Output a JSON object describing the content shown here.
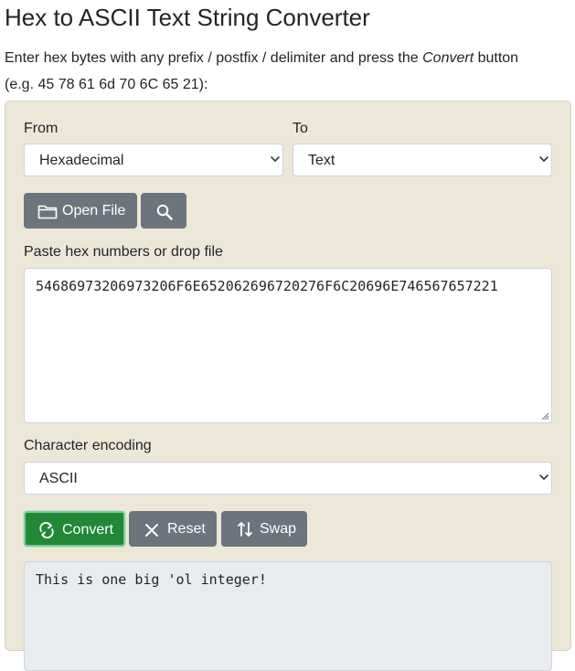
{
  "page": {
    "title": "Hex to ASCII Text String Converter",
    "intro_before": "Enter hex bytes with any prefix / postfix / delimiter and press the ",
    "intro_em": "Convert",
    "intro_after": " button",
    "intro_example": "(e.g. 45 78 61 6d 70 6C 65 21):"
  },
  "form": {
    "from_label": "From",
    "from_value": "Hexadecimal",
    "to_label": "To",
    "to_value": "Text",
    "open_file_label": "Open File",
    "input_label": "Paste hex numbers or drop file",
    "input_value": "54686973206973206F6E652062696720276F6C20696E746567657221",
    "encoding_label": "Character encoding",
    "encoding_value": "ASCII",
    "convert_label": "Convert",
    "reset_label": "Reset",
    "swap_label": "Swap",
    "output_value": "This is one big 'ol integer!"
  },
  "icons": {
    "open_file": "folder-icon",
    "search": "search-icon",
    "convert": "refresh-icon",
    "reset": "close-icon",
    "swap": "swap-vertical-icon",
    "select_arrow": "chevron-down-icon"
  },
  "colors": {
    "panel_bg": "#ede7d7",
    "secondary_button": "#6c757d",
    "convert_button": "#218838",
    "output_bg": "#e9ecef"
  }
}
